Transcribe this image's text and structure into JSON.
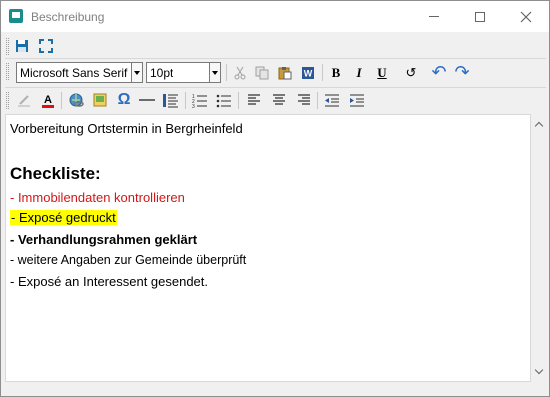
{
  "window": {
    "title": "Beschreibung",
    "icon": "app-window-icon"
  },
  "toolbar_top": {
    "save_icon": "save-icon",
    "fullscreen_icon": "fullscreen-icon"
  },
  "format": {
    "font_family": "Microsoft Sans Serif",
    "font_size": "10pt"
  },
  "buttons": {
    "bold": "B",
    "italic": "I",
    "underline": "U",
    "reset": "↺",
    "undo": "↶",
    "redo": "↷",
    "omega": "Ω"
  },
  "content": {
    "line1": "Vorbereitung Ortstermin in Bergrheinfeld",
    "heading": "Checkliste:",
    "item1": " - Immobilendaten kontrollieren",
    "item2": "- Exposé gedruckt",
    "item3": "- Verhandlungsrahmen geklärt",
    "item4": "- weitere Angaben zur Gemeinde überprüft",
    "item5": "-  Exposé an Interessent gesendet."
  },
  "colors": {
    "red_text": "#d01818",
    "highlight": "#ffff00",
    "accent": "#1a8c8c"
  }
}
